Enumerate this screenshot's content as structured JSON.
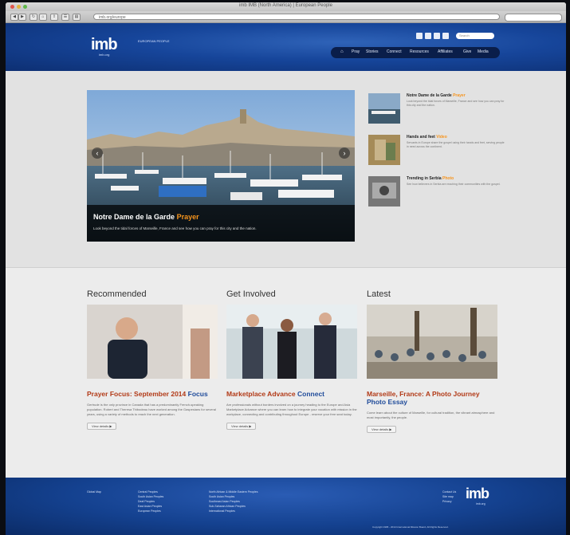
{
  "browser": {
    "window_title": "imb IMB (North America) | European People",
    "url": "imb.org/europe"
  },
  "header": {
    "logo": "imb",
    "logo_sub": "imb.org",
    "tagline": "EUROPEAN PEOPLE",
    "search_placeholder": "Search",
    "nav": [
      "Pray",
      "Stories",
      "Connect",
      "Resources",
      "Affiliates",
      "Give",
      "Media"
    ]
  },
  "hero": {
    "title": "Notre Dame de la Garde",
    "title_tag": "Prayer",
    "text": "Look beyond the tidal forces of Marseille, France and see how you can pray for this city and the nation.",
    "side_items": [
      {
        "title": "Notre Dame de la Garde",
        "tag": "Prayer",
        "text": "Look beyond the tidal forces of Marseille, France and see how you can pray for this city and the nation."
      },
      {
        "title": "Hands and feet",
        "tag": "Video",
        "text": "Servants in Europe share the gospel using their hands and feet, serving people in need across the continent."
      },
      {
        "title": "Trending in Serbia",
        "tag": "Photo",
        "text": "See how believers in Serbia are reaching their communities with the gospel."
      }
    ]
  },
  "columns": [
    {
      "heading": "Recommended",
      "title": "Prayer Focus: September 2014",
      "title_tag": "Focus",
      "text": "Gertrude is the only province in Canada that has a predominantly French-speaking population. Robert and Theresa Thibodeau have worked among the Gaspesians for several years, using a variety of methods to reach the next generation.",
      "more": "View details ▶"
    },
    {
      "heading": "Get Involved",
      "title": "Marketplace Advance",
      "title_tag": "Connect",
      "text": "Are professionals without borders involved on a journey heading to the Europe and Asia Marketplace Advance where you can learn how to integrate your vocation with mission in the workplace, connecting and contributing throughout Europe - reserve your free seat today.",
      "more": "View details ▶"
    },
    {
      "heading": "Latest",
      "title": "Marseille, France: A Photo Journey",
      "title_tag": "Photo Essay",
      "text": "Come learn about the culture of Marseille, for cultural tradition, the vibrant atmosphere and most importantly, the people.",
      "more": "View details ▶"
    }
  ],
  "footer": {
    "col0": [
      "Global Map"
    ],
    "col1": [
      "Central Peoples",
      "South Asian Peoples",
      "Deaf Peoples",
      "East Asian Peoples",
      "European Peoples"
    ],
    "col2": [
      "North African & Middle Eastern Peoples",
      "South Asian Peoples",
      "Southeast Asian Peoples",
      "Sub-Saharan African Peoples",
      "International Peoples"
    ],
    "col3": [
      "Contact Us",
      "Site map",
      "Privacy"
    ],
    "logo": "imb",
    "logo_sub": "imb.org",
    "copyright": "Copyright 1995 - 2014 International Mission Board, All Rights Reserved."
  },
  "colors": {
    "brand_blue": "#16459a",
    "accent_orange": "#f6941d",
    "title_red": "#b23a17"
  }
}
